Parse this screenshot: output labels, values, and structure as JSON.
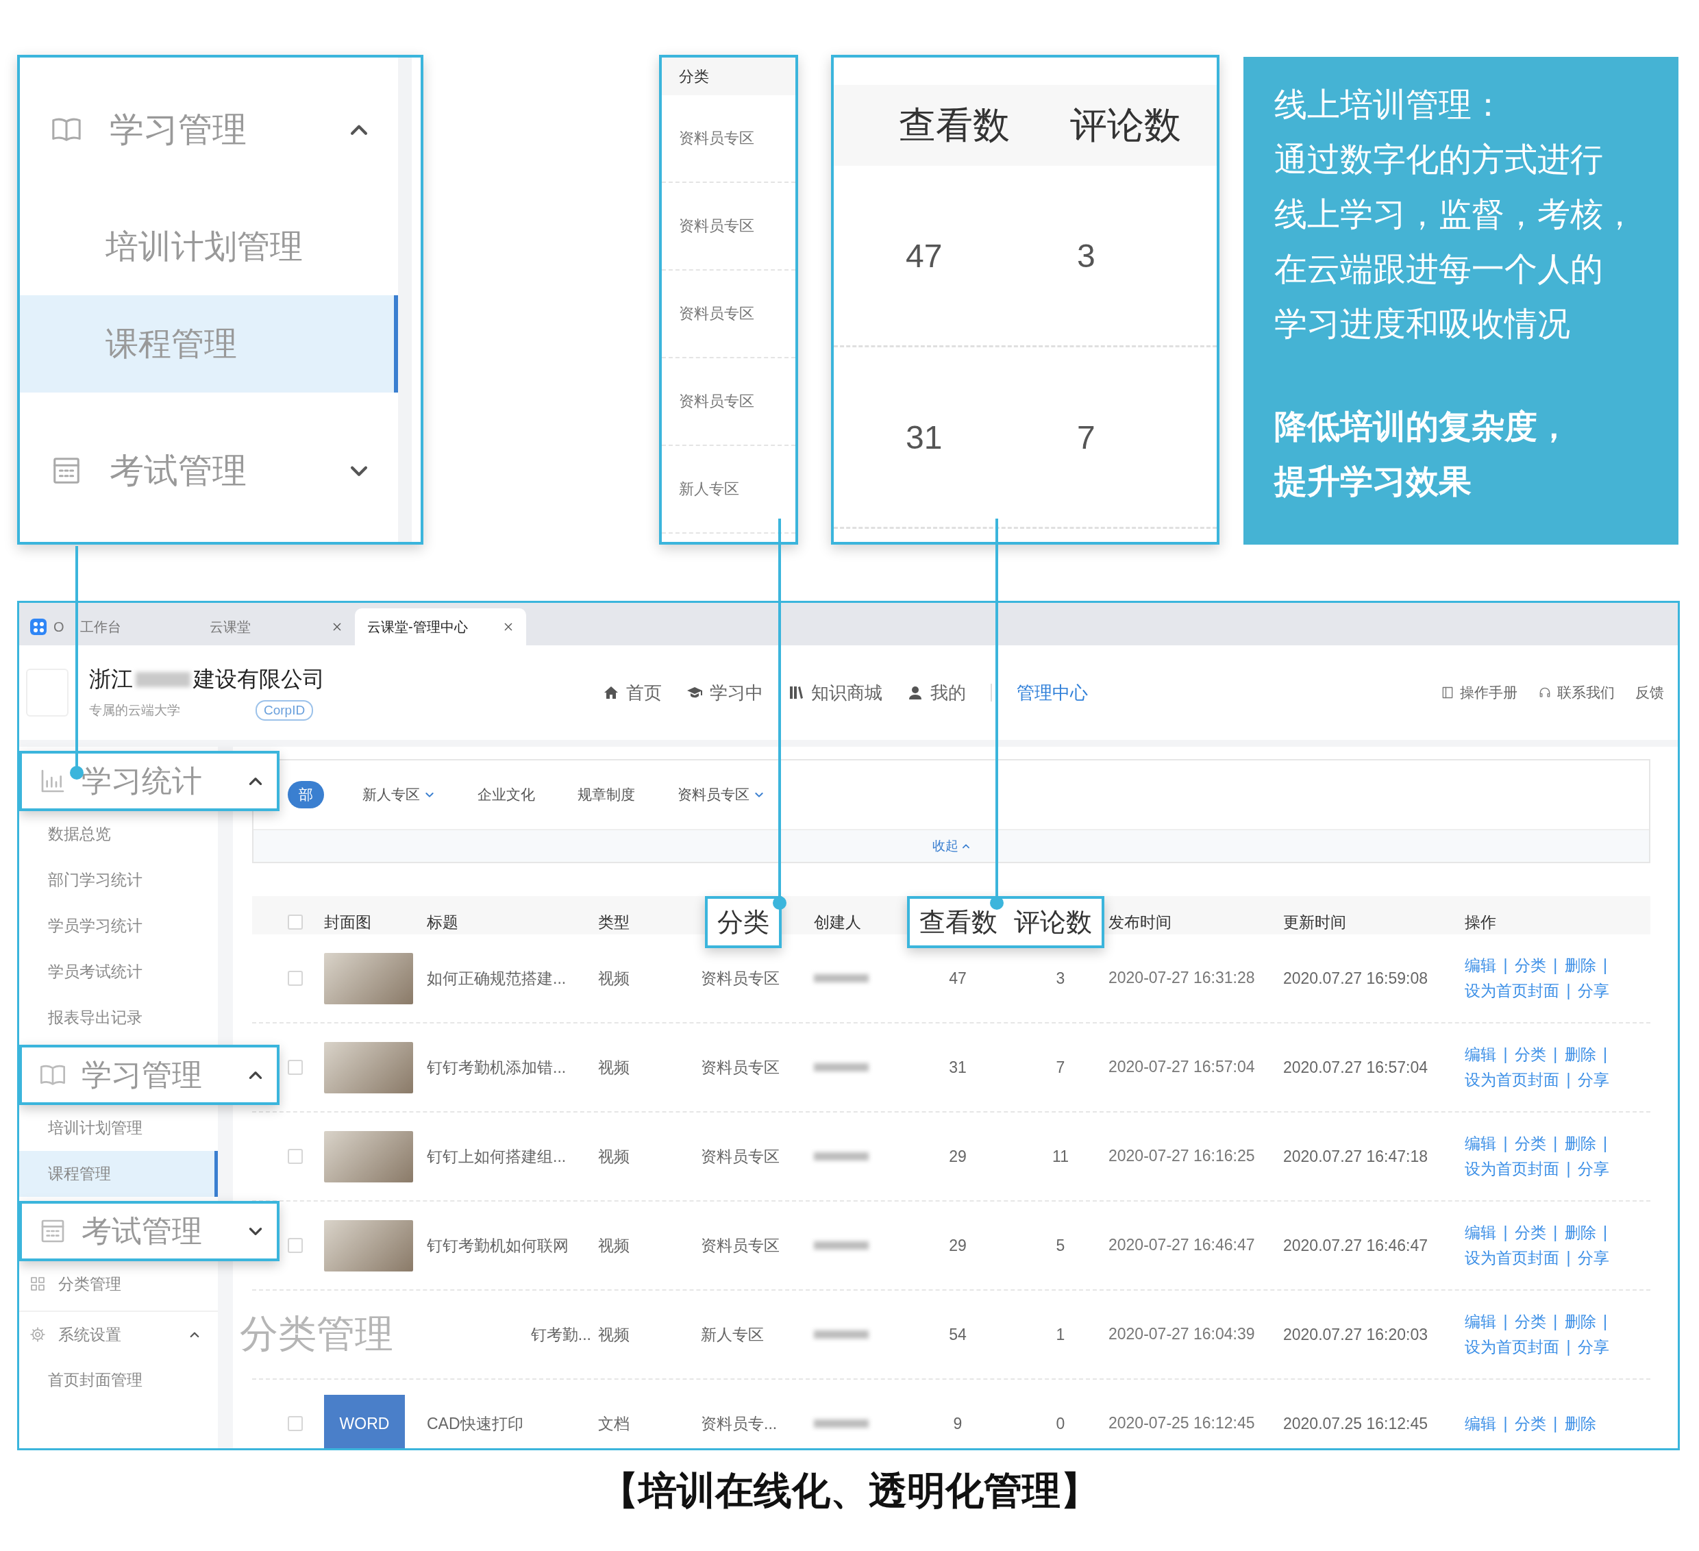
{
  "zoom_callouts": {
    "sidebar": {
      "groups": [
        {
          "label": "学习管理",
          "expanded": true,
          "items": [
            {
              "label": "培训计划管理",
              "selected": false
            },
            {
              "label": "课程管理",
              "selected": true
            }
          ]
        },
        {
          "label": "考试管理",
          "expanded": false
        }
      ]
    },
    "category_column": {
      "header": "分类",
      "cells": [
        "资料员专区",
        "资料员专区",
        "资料员专区",
        "资料员专区",
        "新人专区"
      ]
    },
    "count_columns": {
      "headers": [
        "查看数",
        "评论数"
      ],
      "rows": [
        [
          "47",
          "3"
        ],
        [
          "31",
          "7"
        ]
      ]
    }
  },
  "summary": {
    "lines": [
      "线上培训管理：",
      "通过数字化的方式进行",
      "线上学习，监督，考核，",
      "在云端跟进每一个人的",
      "学习进度和吸收情况"
    ],
    "emphasis": [
      "降低培训的复杂度，",
      "提升学习效果"
    ]
  },
  "app": {
    "tabs": [
      {
        "label": "O 工作台",
        "selected": false,
        "closable": false
      },
      {
        "label": "云课堂",
        "selected": false,
        "closable": true
      },
      {
        "label": "云课堂-管理中心",
        "selected": true,
        "closable": true
      }
    ],
    "company": {
      "name_start": "浙江",
      "name_end": "建设有限公司",
      "subtitle": "专属的云端大学",
      "badge": "CorpID"
    },
    "nav": [
      {
        "label": "首页",
        "selected": false
      },
      {
        "label": "学习中",
        "selected": false
      },
      {
        "label": "知识商城",
        "selected": false
      },
      {
        "label": "我的",
        "selected": false
      },
      {
        "label": "管理中心",
        "selected": true
      }
    ],
    "header_links": [
      "操作手册",
      "联系我们",
      "反馈"
    ],
    "sidebar": {
      "groups": [
        {
          "label": "学习统计",
          "callout": true,
          "expanded": true,
          "items": [
            {
              "label": "数据总览",
              "selected": false
            },
            {
              "label": "部门学习统计",
              "selected": false
            },
            {
              "label": "学员学习统计",
              "selected": false
            },
            {
              "label": "学员考试统计",
              "selected": false
            },
            {
              "label": "报表导出记录",
              "selected": false
            }
          ]
        },
        {
          "label": "学习管理",
          "callout": true,
          "expanded": true,
          "items": [
            {
              "label": "培训计划管理",
              "selected": false
            },
            {
              "label": "课程管理",
              "selected": true
            }
          ]
        },
        {
          "label": "考试管理",
          "callout": true,
          "expanded": false
        },
        {
          "label": "分类管理",
          "callout": false
        },
        {
          "label": "系统设置",
          "callout": false,
          "expanded": true,
          "items": [
            {
              "label": "首页封面管理",
              "selected": false
            }
          ]
        }
      ]
    },
    "filters": {
      "tags": [
        {
          "label": "部",
          "selected": true,
          "dropdown": false
        },
        {
          "label": "新人专区",
          "selected": false,
          "dropdown": true
        },
        {
          "label": "企业文化",
          "selected": false,
          "dropdown": false
        },
        {
          "label": "规章制度",
          "selected": false,
          "dropdown": false
        },
        {
          "label": "资料员专区",
          "selected": false,
          "dropdown": true
        }
      ],
      "collapse_link": "收起"
    },
    "table": {
      "header_checked": false,
      "op_separator": "|",
      "columns": [
        {
          "label": "封面图",
          "highlight": false
        },
        {
          "label": "标题",
          "highlight": false
        },
        {
          "label": "类型",
          "highlight": false
        },
        {
          "label": "分类",
          "highlight": true
        },
        {
          "label": "创建人",
          "highlight": false
        },
        {
          "label": "查看数",
          "highlight": true
        },
        {
          "label": "评论数",
          "highlight": true
        },
        {
          "label": "发布时间",
          "highlight": false
        },
        {
          "label": "更新时间",
          "highlight": false
        },
        {
          "label": "操作",
          "highlight": false
        }
      ],
      "rows": [
        {
          "checked": false,
          "cover": {
            "kind": "photo"
          },
          "title": "如何正确规范搭建...",
          "type": "视频",
          "category": "资料员专区",
          "views": "47",
          "comments": "3",
          "published": "2020-07-27 16:31:28",
          "updated": "2020.07.27 16:59:08",
          "ops": [
            "编辑",
            "分类",
            "删除",
            "设为首页封面",
            "分享"
          ]
        },
        {
          "checked": false,
          "cover": {
            "kind": "photo"
          },
          "title": "钉钉考勤机添加错...",
          "type": "视频",
          "category": "资料员专区",
          "views": "31",
          "comments": "7",
          "published": "2020-07-27 16:57:04",
          "updated": "2020.07.27 16:57:04",
          "ops": [
            "编辑",
            "分类",
            "删除",
            "设为首页封面",
            "分享"
          ]
        },
        {
          "checked": false,
          "cover": {
            "kind": "photo"
          },
          "title": "钉钉上如何搭建组...",
          "type": "视频",
          "category": "资料员专区",
          "views": "29",
          "comments": "11",
          "published": "2020-07-27 16:16:25",
          "updated": "2020.07.27 16:47:18",
          "ops": [
            "编辑",
            "分类",
            "删除",
            "设为首页封面",
            "分享"
          ]
        },
        {
          "checked": false,
          "cover": {
            "kind": "photo"
          },
          "title": "钉钉考勤机如何联网",
          "type": "视频",
          "category": "资料员专区",
          "views": "29",
          "comments": "5",
          "published": "2020-07-27 16:46:47",
          "updated": "2020.07.27 16:46:47",
          "ops": [
            "编辑",
            "分类",
            "删除",
            "设为首页封面",
            "分享"
          ]
        },
        {
          "overlay": {
            "label": "分类管理"
          },
          "title": "钉考勤...",
          "type": "视频",
          "category": "新人专区",
          "views": "54",
          "comments": "1",
          "published": "2020-07-27 16:04:39",
          "updated": "2020.07.27 16:20:03",
          "ops": [
            "编辑",
            "分类",
            "删除",
            "设为首页封面",
            "分享"
          ]
        },
        {
          "checked": false,
          "cover": {
            "kind": "word",
            "label": "WORD"
          },
          "title": "CAD快速打印",
          "type": "文档",
          "category": "资料员专...",
          "views": "9",
          "comments": "0",
          "published": "2020-07-25 16:12:45",
          "updated": "2020.07.25 16:12:45",
          "ops": [
            "编辑",
            "分类",
            "删除"
          ]
        }
      ]
    }
  },
  "caption": "【培训在线化、透明化管理】"
}
